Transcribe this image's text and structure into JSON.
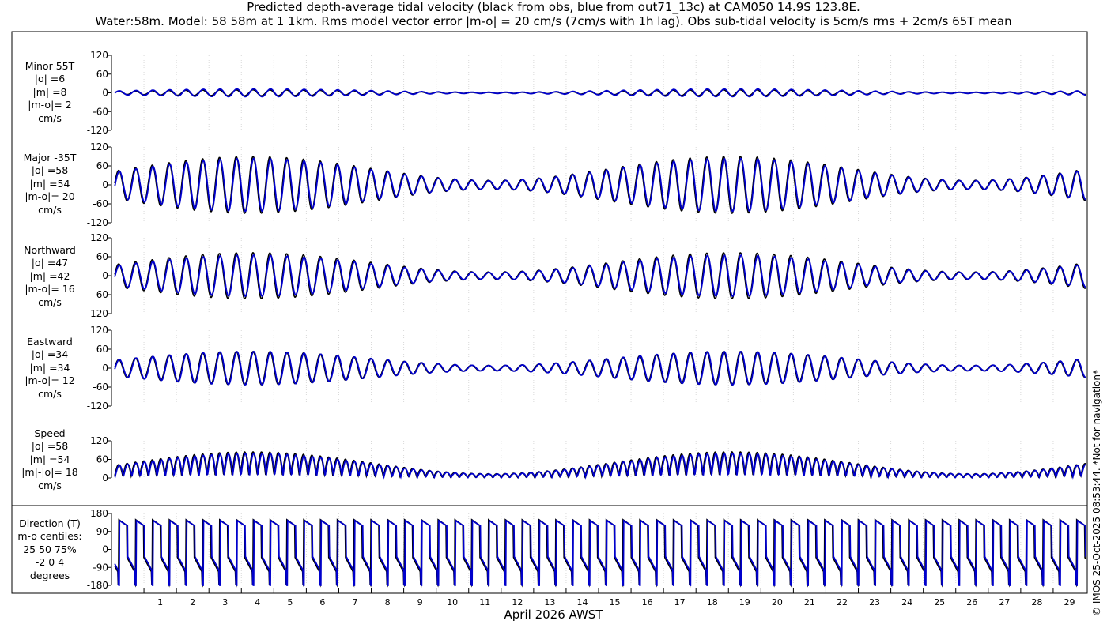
{
  "title": {
    "line1": "Predicted depth-average tidal velocity (black from obs, blue from out71_13c) at CAM050 14.9S 123.8E.",
    "line2": "Water:58m. Model: 58 58m at 1 1km. Rms model vector error |m-o| = 20 cm/s (7cm/s with 1h lag). Obs sub-tidal velocity is 5cm/s rms + 2cm/s 65T mean"
  },
  "side_note": "© IMOS 25-Oct-2025 08:53:44. *Not for navigation*",
  "xlabel": "April 2026 AWST",
  "colors": {
    "obs": "#000000",
    "model": "#0000cc",
    "grid": "#d9d9d9",
    "frame": "#000000"
  },
  "chart_data": {
    "type": "line",
    "x_ticks": [
      "1",
      "2",
      "3",
      "4",
      "5",
      "6",
      "7",
      "8",
      "9",
      "10",
      "11",
      "12",
      "13",
      "14",
      "15",
      "16",
      "17",
      "18",
      "19",
      "20",
      "21",
      "22",
      "23",
      "24",
      "25",
      "26",
      "27",
      "28",
      "29"
    ],
    "xlim_days": [
      0.0,
      30.0
    ],
    "series_legend": [
      "black from obs",
      "blue from out71_13c"
    ],
    "panels": [
      {
        "id": "minor",
        "label": [
          "Minor 55T",
          "|o| =6",
          "|m| =8",
          "|m-o|= 2",
          "cm/s"
        ],
        "yticks": [
          "120",
          "60",
          "0",
          "-60",
          "-120"
        ],
        "ylim": [
          -120,
          120
        ],
        "amp_obs": 6,
        "amp_model": 8,
        "signal": "tide"
      },
      {
        "id": "major",
        "label": [
          "Major -35T",
          "|o| =58",
          "|m| =54",
          "|m-o|= 20",
          "cm/s"
        ],
        "yticks": [
          "120",
          "60",
          "0",
          "-60",
          "-120"
        ],
        "ylim": [
          -120,
          120
        ],
        "amp_obs": 58,
        "amp_model": 54,
        "signal": "tide"
      },
      {
        "id": "north",
        "label": [
          "Northward",
          "|o| =47",
          "|m| =42",
          "|m-o|= 16",
          "cm/s"
        ],
        "yticks": [
          "120",
          "60",
          "0",
          "-60",
          "-120"
        ],
        "ylim": [
          -120,
          120
        ],
        "amp_obs": 47,
        "amp_model": 42,
        "signal": "tide"
      },
      {
        "id": "east",
        "label": [
          "Eastward",
          "|o| =34",
          "|m| =34",
          "|m-o|= 12",
          "cm/s"
        ],
        "yticks": [
          "120",
          "60",
          "0",
          "-60",
          "-120"
        ],
        "ylim": [
          -120,
          120
        ],
        "amp_obs": 34,
        "amp_model": 34,
        "signal": "tide"
      },
      {
        "id": "speed",
        "label": [
          "Speed",
          "|o| =58",
          "|m| =54",
          "|m|-|o|= 18",
          "cm/s"
        ],
        "yticks": [
          "120",
          "60",
          "0"
        ],
        "ylim": [
          0,
          120
        ],
        "amp_obs": 58,
        "amp_model": 54,
        "signal": "speed"
      },
      {
        "id": "direction",
        "label": [
          "Direction (T)",
          "m-o centiles:",
          "25  50  75%",
          "-2  0  4",
          "degrees"
        ],
        "yticks": [
          "180",
          "90",
          "0",
          "-90",
          "-180"
        ],
        "ylim": [
          -180,
          180
        ],
        "signal": "direction"
      }
    ]
  }
}
